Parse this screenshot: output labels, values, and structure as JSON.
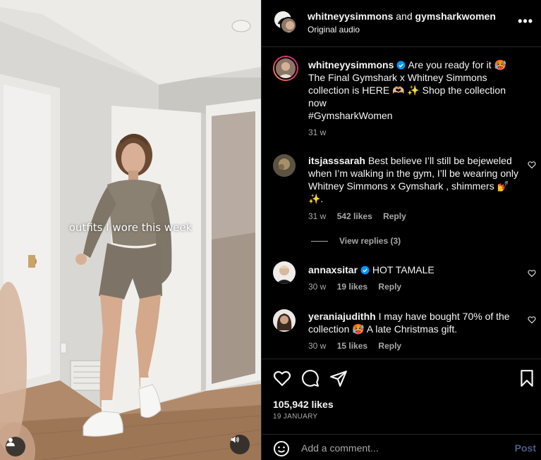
{
  "post": {
    "header": {
      "author": "whitneyysimmons",
      "and": "and",
      "collaborator": "gymsharkwomen",
      "audio": "Original audio",
      "more": "•••"
    },
    "video": {
      "overlay_text": "outfits I wore this week",
      "profile_icon": "user-icon",
      "sound_icon": "speaker-icon"
    },
    "caption": {
      "username": "whitneyysimmons",
      "text_1": "Are you ready for it 🥵 The Final Gymshark x Whitney Simmons collection is HERE 🫶🏼 ✨ Shop the collection now",
      "hashtag": "#GymsharkWomen",
      "time": "31 w"
    },
    "comments": [
      {
        "username": "itsjasssarah",
        "text": "Best believe I’ll still be bejeweled when I’m walking in the gym, I’ll be wearing only Whitney Simmons x Gymshark , shimmers 💅 ✨.",
        "time": "31 w",
        "likes": "542 likes",
        "reply": "Reply",
        "view_replies": "View replies (3)"
      },
      {
        "username": "annaxsitar",
        "text": "HOT TAMALE",
        "time": "30 w",
        "likes": "19 likes",
        "reply": "Reply"
      },
      {
        "username": "yeraniajudithh",
        "text": "I may have bought 70% of the collection 🥵 A late Christmas gift.",
        "time": "30 w",
        "likes": "15 likes",
        "reply": "Reply"
      }
    ],
    "likes_count": "105,942 likes",
    "date": "19 JANUARY",
    "add_comment": {
      "placeholder": "Add a comment...",
      "post_label": "Post"
    },
    "colors": {
      "background": "#000000",
      "text": "#f5f5f5",
      "muted": "#a8a8a8",
      "verified": "#0095f6",
      "post_disabled": "#4a5d8a"
    }
  }
}
